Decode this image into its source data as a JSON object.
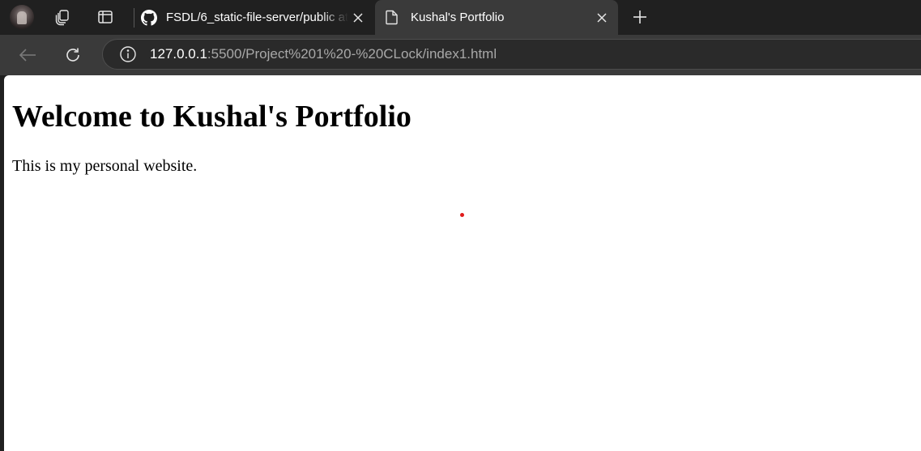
{
  "tabs": [
    {
      "title": "FSDL/6_static-file-server/public at",
      "favicon": "github-icon",
      "active": false
    },
    {
      "title": "Kushal's Portfolio",
      "favicon": "document-icon",
      "active": true
    }
  ],
  "address_bar": {
    "url_host": "127.0.0.1",
    "url_rest": ":5500/Project%201%20-%20CLock/index1.html"
  },
  "page": {
    "heading": "Welcome to Kushal's Portfolio",
    "paragraph": "This is my personal website."
  },
  "colors": {
    "chrome_dark": "#202020",
    "toolbar": "#3a3a3a",
    "dot": "#e01b1b"
  }
}
